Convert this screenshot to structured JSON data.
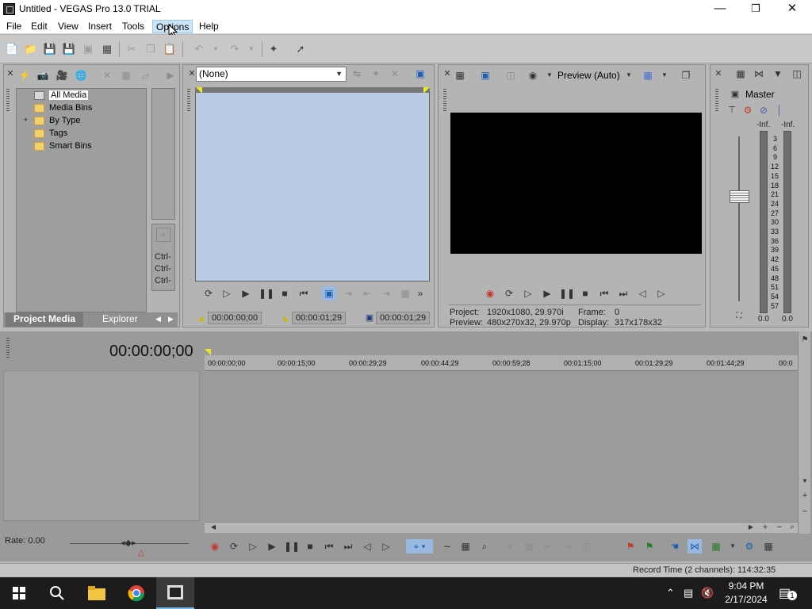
{
  "window": {
    "title": "Untitled - VEGAS Pro 13.0 TRIAL"
  },
  "menu": [
    "File",
    "Edit",
    "View",
    "Insert",
    "Tools",
    "Options",
    "Help"
  ],
  "project_media": {
    "tree": [
      "All Media",
      "Media Bins",
      "By Type",
      "Tags",
      "Smart Bins"
    ],
    "ctrl_labels": [
      "Ctrl-",
      "Ctrl-",
      "Ctrl-"
    ],
    "tabs": [
      "Project Media",
      "Explorer"
    ]
  },
  "trimmer": {
    "dropdown": "(None)",
    "tc_start": "00:00:00;00",
    "tc_end": "00:00:01;29",
    "tc_length": "00:00:01;29"
  },
  "preview": {
    "mode": "Preview (Auto)",
    "project_label": "Project:",
    "project_value": "1920x1080, 29.970i",
    "preview_label": "Preview:",
    "preview_value": "480x270x32, 29.970p",
    "frame_label": "Frame:",
    "frame_value": "0",
    "display_label": "Display:",
    "display_value": "317x178x32"
  },
  "master": {
    "label": "Master",
    "peak_left": "-Inf.",
    "peak_right": "-Inf.",
    "scale": [
      "3",
      "6",
      "9",
      "12",
      "15",
      "18",
      "21",
      "24",
      "27",
      "30",
      "33",
      "36",
      "39",
      "42",
      "45",
      "48",
      "51",
      "54",
      "57"
    ],
    "value_left": "0.0",
    "value_right": "0.0"
  },
  "timeline": {
    "timecode": "00:00:00;00",
    "ruler": [
      "00:00:00;00",
      "00:00:15;00",
      "00:00:29;29",
      "00:00:44;29",
      "00:00:59;28",
      "00:01:15;00",
      "00:01:29;29",
      "00:01:44;29",
      "00:0"
    ],
    "rate": "Rate: 0.00"
  },
  "status": {
    "record_time": "Record Time (2 channels): 114:32:35"
  },
  "taskbar": {
    "time": "9:04 PM",
    "date": "2/17/2024",
    "notifications": "1"
  }
}
